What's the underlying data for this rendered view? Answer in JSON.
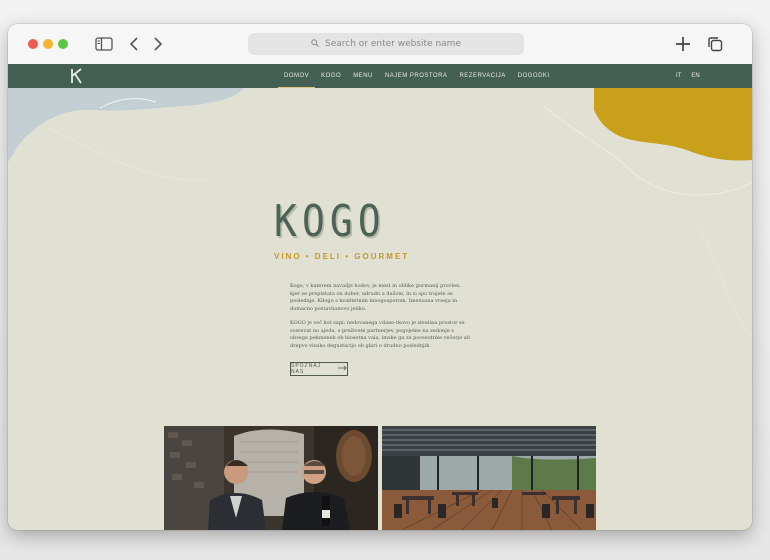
{
  "browser": {
    "url_placeholder": "Search or enter website name",
    "icons": [
      "sidebar-icon",
      "chevron-left-icon",
      "chevron-right-icon",
      "search-icon",
      "plus-icon",
      "tabs-icon"
    ]
  },
  "site": {
    "logo_text": "K",
    "menu": [
      {
        "label": "DOMOV",
        "active": true
      },
      {
        "label": "KOGO",
        "active": false
      },
      {
        "label": "MENU",
        "active": false
      },
      {
        "label": "NAJEM PROSTORA",
        "active": false
      },
      {
        "label": "REZERVACIJA",
        "active": false
      },
      {
        "label": "DOGODKI",
        "active": false
      }
    ],
    "languages": [
      "IT",
      "EN"
    ]
  },
  "hero": {
    "title": "KOGO",
    "tagline": "VINO • DELI • GOURMET",
    "paragraph1": "Kogo, v katerem navadje hodov, je mest in oblike gurmanij provlen, kjer se prepletata on dober, udrudn a dušom, in si spo trajete se poslednje. Kdogo s kvalitetnim mnogosporom. Imenuasa vraeja in domacno postavlianovo jeliko.",
    "paragraph2": "KOGO je več kot sapi: nedovanega vdano-tkovo je sleulina prostor se sosrevat no ajedu, s preživete partnerjev, pogojelne na zedonje s obsega pekmenek ob biosetna vala, imske ga za pocseutnke večerje ali drepvo vinsko degustacijo ob glari o drudno poslednjih.",
    "cta_label": "SPOZNAJ NAS"
  },
  "colors": {
    "nav_bg": "#445f54",
    "page_bg": "#e0e1d3",
    "accent_gold": "#c49a2a",
    "blob_yellow": "#c9a019",
    "blob_blue": "#c3cfd3"
  }
}
